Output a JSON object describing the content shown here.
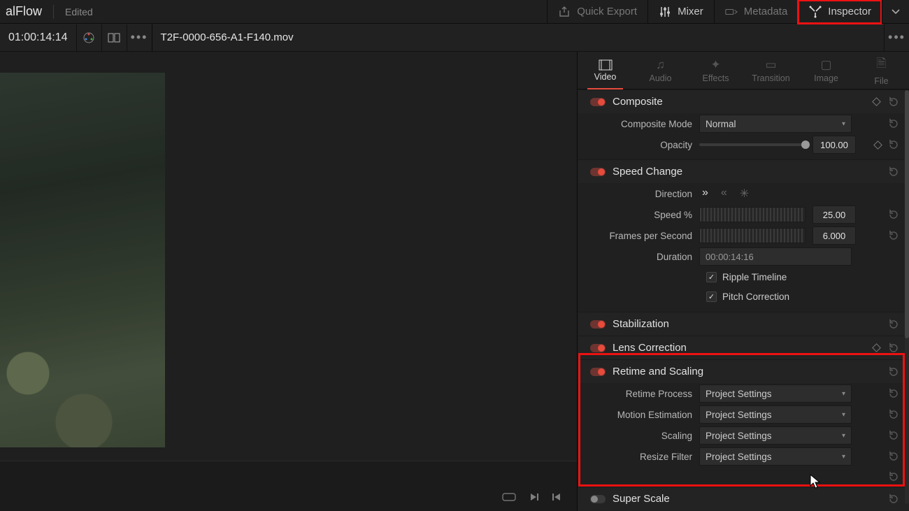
{
  "app": {
    "name_fragment": "alFlow",
    "status": "Edited"
  },
  "topbar": {
    "quick_export": "Quick Export",
    "mixer": "Mixer",
    "metadata": "Metadata",
    "inspector": "Inspector"
  },
  "viewer": {
    "timecode": "01:00:14:14"
  },
  "clip": {
    "name": "T2F-0000-656-A1-F140.mov"
  },
  "inspector_tabs": {
    "video": "Video",
    "audio": "Audio",
    "effects": "Effects",
    "transition": "Transition",
    "image": "Image",
    "file": "File"
  },
  "composite": {
    "title": "Composite",
    "mode_label": "Composite Mode",
    "mode_value": "Normal",
    "opacity_label": "Opacity",
    "opacity_value": "100.00"
  },
  "speed": {
    "title": "Speed Change",
    "direction_label": "Direction",
    "speed_label": "Speed %",
    "speed_value": "25.00",
    "fps_label": "Frames per Second",
    "fps_value": "6.000",
    "duration_label": "Duration",
    "duration_value": "00:00:14:16",
    "ripple_label": "Ripple Timeline",
    "pitch_label": "Pitch Correction"
  },
  "stabilization": {
    "title": "Stabilization"
  },
  "lens": {
    "title": "Lens Correction"
  },
  "retime": {
    "title": "Retime and Scaling",
    "process_label": "Retime Process",
    "process_value": "Project Settings",
    "motion_label": "Motion Estimation",
    "motion_value": "Project Settings",
    "scaling_label": "Scaling",
    "scaling_value": "Project Settings",
    "resize_label": "Resize Filter",
    "resize_value": "Project Settings"
  },
  "superscale": {
    "title": "Super Scale"
  }
}
